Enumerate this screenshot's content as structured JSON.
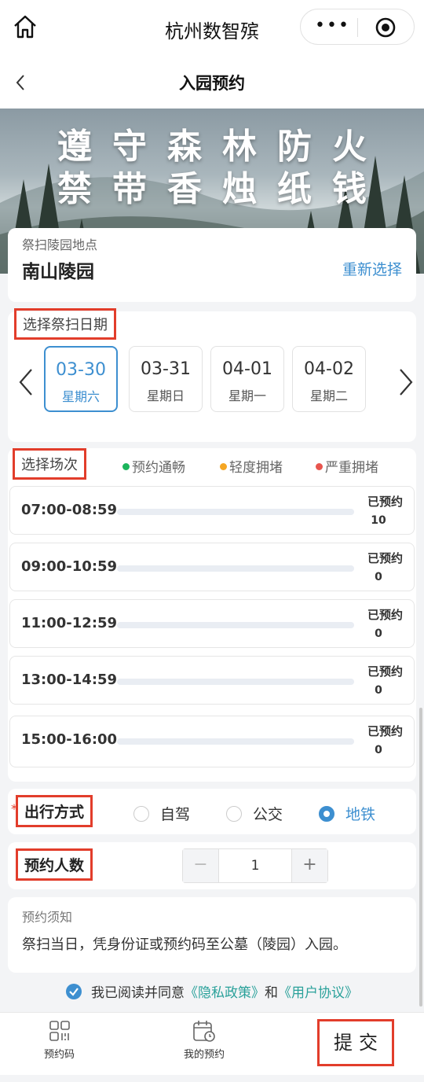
{
  "app": {
    "title": "杭州数智殡"
  },
  "nav": {
    "title": "入园预约"
  },
  "banner": {
    "line1": "遵守森林防火",
    "line2": "禁带香烛纸钱"
  },
  "location": {
    "label": "祭扫陵园地点",
    "name": "南山陵园",
    "reselect": "重新选择"
  },
  "date_section": {
    "label": "选择祭扫日期",
    "dates": [
      {
        "date": "03-30",
        "weekday": "星期六",
        "selected": true
      },
      {
        "date": "03-31",
        "weekday": "星期日",
        "selected": false
      },
      {
        "date": "04-01",
        "weekday": "星期一",
        "selected": false
      },
      {
        "date": "04-02",
        "weekday": "星期二",
        "selected": false
      }
    ]
  },
  "session_section": {
    "label": "选择场次",
    "legend": [
      {
        "label": "预约通畅",
        "color": "#1bb55c"
      },
      {
        "label": "轻度拥堵",
        "color": "#f5a623"
      },
      {
        "label": "严重拥堵",
        "color": "#e8554e"
      }
    ],
    "booked_label": "已预约",
    "slots": [
      {
        "time": "07:00-08:59",
        "booked": "10"
      },
      {
        "time": "09:00-10:59",
        "booked": "0"
      },
      {
        "time": "11:00-12:59",
        "booked": "0"
      },
      {
        "time": "13:00-14:59",
        "booked": "0"
      },
      {
        "time": "15:00-16:00",
        "booked": "0"
      }
    ]
  },
  "travel": {
    "label": "出行方式",
    "required_mark": "*",
    "options": [
      {
        "label": "自驾",
        "checked": false
      },
      {
        "label": "公交",
        "checked": false
      },
      {
        "label": "地铁",
        "checked": true
      }
    ]
  },
  "people": {
    "label": "预约人数",
    "minus": "−",
    "plus": "+",
    "value": "1"
  },
  "notice": {
    "title": "预约须知",
    "text": "祭扫当日，凭身份证或预约码至公墓（陵园）入园。"
  },
  "agreement": {
    "prefix": "我已阅读并同意",
    "privacy": "《隐私政策》",
    "and": "和",
    "terms": "《用户协议》"
  },
  "tabbar": {
    "qrcode": "预约码",
    "my_booking": "我的预约",
    "submit": "提交"
  },
  "colors": {
    "accent": "#3d8fd0",
    "highlight_box": "#e23d2b",
    "link": "#2aa19a"
  }
}
